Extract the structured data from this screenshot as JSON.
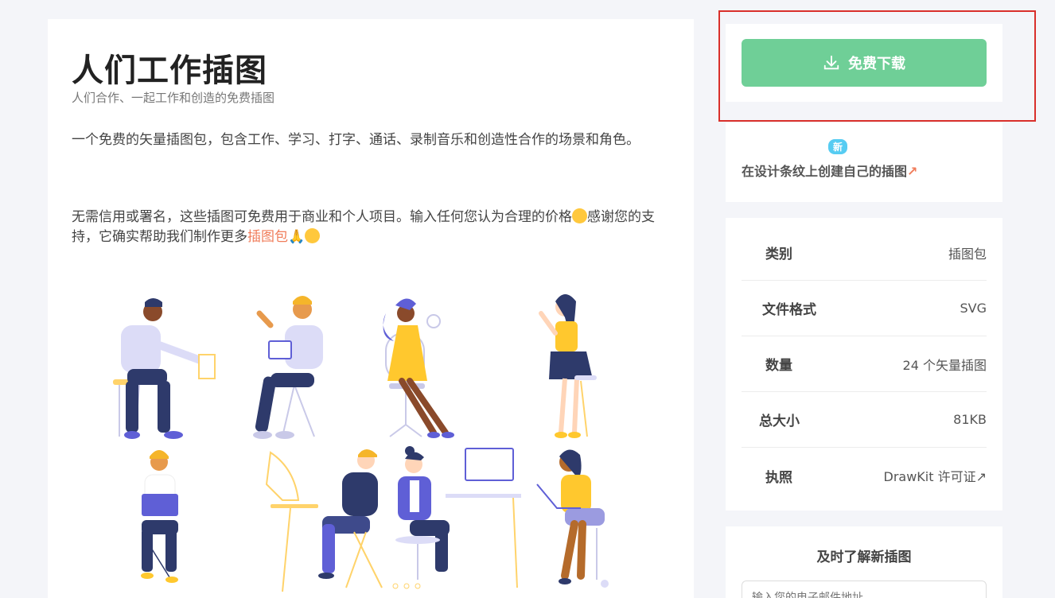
{
  "page": {
    "title": "人们工作插图",
    "subtitle": "人们合作、一起工作和创造的免费插图",
    "description_1": "一个免费的矢量插图包，包含工作、学习、打字、通话、录制音乐和创造性合作的场景和角色。",
    "description_2_part1": "无需信用或署名，这些插图可免费用于商业和个人项目。输入任何您认为合理的价格",
    "description_2_part2": "感谢您的支持，它确实帮助我们制作更多",
    "description_2_link": "插图包"
  },
  "download": {
    "button_label": "免费下载",
    "icon": "download-icon"
  },
  "promo": {
    "badge": "新",
    "text": "在设计条纹上创建自己的插图",
    "arrow": "↗"
  },
  "info": {
    "rows": [
      {
        "label": "类别",
        "value": "插图包"
      },
      {
        "label": "文件格式",
        "value": "SVG"
      },
      {
        "label": "数量",
        "value": "24 个矢量插图"
      },
      {
        "label": "总大小",
        "value": "81KB"
      },
      {
        "label": "执照",
        "value": "DrawKit 许可证↗"
      }
    ]
  },
  "newsletter": {
    "title": "及时了解新插图",
    "placeholder": "输入您的电子邮件地址"
  },
  "colors": {
    "accent_green": "#6fcf97",
    "link_orange": "#f07c5a",
    "badge_blue": "#56ccf2",
    "highlight_red": "#d9302b"
  }
}
